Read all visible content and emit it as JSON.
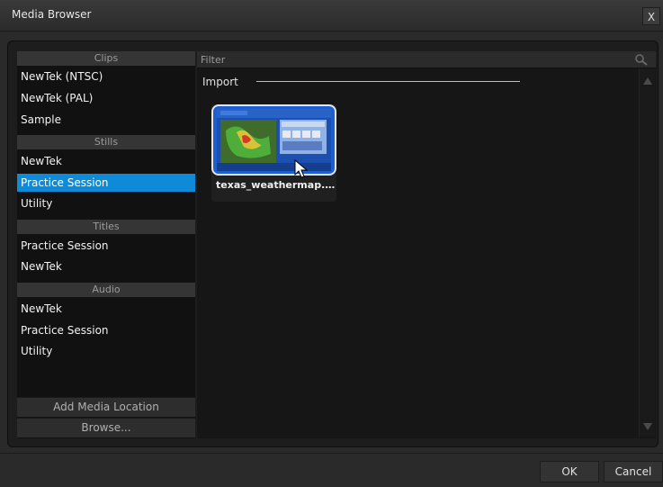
{
  "window": {
    "title": "Media Browser",
    "close_label": "X"
  },
  "sidebar": {
    "sections": [
      {
        "header": "Clips",
        "items": [
          "NewTek (NTSC)",
          "NewTek (PAL)",
          "Sample"
        ]
      },
      {
        "header": "Stills",
        "items": [
          "NewTek",
          "Practice Session",
          "Utility"
        ]
      },
      {
        "header": "Titles",
        "items": [
          "Practice Session",
          "NewTek"
        ]
      },
      {
        "header": "Audio",
        "items": [
          "NewTek",
          "Practice Session",
          "Utility"
        ]
      }
    ],
    "selected_item": "Stills / Practice Session",
    "add_location_label": "Add Media Location",
    "browse_label": "Browse..."
  },
  "filter": {
    "placeholder": "Filter",
    "icon": "search-icon"
  },
  "content": {
    "group_label": "Import",
    "items": [
      {
        "name": "texas_weathermap.p..."
      }
    ]
  },
  "footer": {
    "ok_label": "OK",
    "cancel_label": "Cancel"
  },
  "colors": {
    "selection": "#0d8ad8",
    "background": "#2a2a2a",
    "panel": "#111111"
  }
}
